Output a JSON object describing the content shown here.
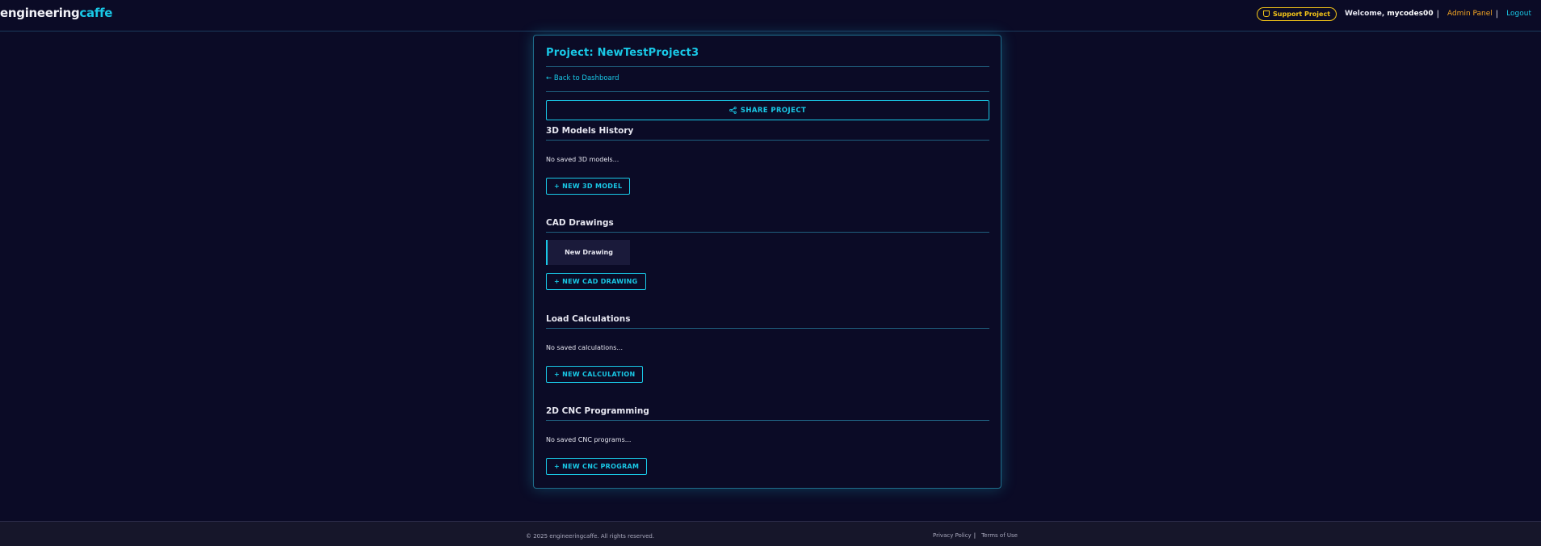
{
  "header": {
    "logo_main": "engineering",
    "logo_accent": "caffe",
    "support_label": "Support Project",
    "welcome_prefix": "Welcome,",
    "username": "mycodes00",
    "admin_label": "Admin Panel",
    "logout_label": "Logout"
  },
  "project": {
    "title": "Project: NewTestProject3",
    "back_label": "← Back to Dashboard",
    "share_label": "SHARE PROJECT"
  },
  "sections": {
    "models": {
      "title": "3D Models History",
      "empty": "No saved 3D models...",
      "button": "+ NEW 3D MODEL"
    },
    "cad": {
      "title": "CAD Drawings",
      "items": [
        {
          "label": "New Drawing"
        }
      ],
      "button": "+ NEW CAD DRAWING"
    },
    "load": {
      "title": "Load Calculations",
      "empty": "No saved calculations...",
      "button": "+ NEW CALCULATION"
    },
    "cnc": {
      "title": "2D CNC Programming",
      "empty": "No saved CNC programs...",
      "button": "+ NEW CNC PROGRAM"
    }
  },
  "footer": {
    "copyright": "© 2025 engineeringcaffe. All rights reserved.",
    "privacy_label": "Privacy Policy",
    "terms_label": "Terms of Use"
  },
  "colors": {
    "background": "#0b0b26",
    "accent": "#19c8e6",
    "support": "#f5c518",
    "admin": "#f5a623"
  },
  "icons": {
    "support": "coffee-cup-icon",
    "share": "share-icon"
  }
}
